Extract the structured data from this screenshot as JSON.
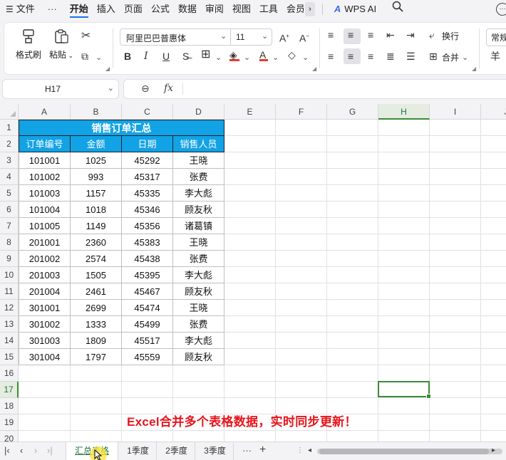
{
  "menubar": {
    "file_icon": "hamburger-menu-icon",
    "file_label": "文件",
    "more_label": "···",
    "items": [
      "开始",
      "插入",
      "页面",
      "公式",
      "数据",
      "审阅",
      "视图",
      "工具",
      "会员"
    ],
    "active": "开始",
    "wps_ai_label": "WPS AI",
    "accent_color": "#1a73e8"
  },
  "ribbon": {
    "format_painter_label": "格式刷",
    "paste_label": "粘贴",
    "font_name": "阿里巴巴普惠体",
    "font_size": "11",
    "bold": "B",
    "italic": "I",
    "underline": "U",
    "wrap_label": "换行",
    "merge_label": "合并",
    "number_format_label": "常规",
    "currency_symbol": "羊"
  },
  "formula_bar": {
    "name_box": "H17",
    "fx_label": "fx",
    "formula": ""
  },
  "grid": {
    "columns": [
      "A",
      "B",
      "C",
      "D",
      "E",
      "F",
      "G",
      "H",
      "I",
      "J"
    ],
    "selected_column": "H",
    "rows": [
      "1",
      "2",
      "3",
      "4",
      "5",
      "6",
      "7",
      "8",
      "9",
      "10",
      "11",
      "12",
      "13",
      "14",
      "15",
      "16",
      "17",
      "18",
      "19",
      "20"
    ],
    "selected_row": "17",
    "table_title": "销售订单汇总",
    "headers": [
      "订单编号",
      "金额",
      "日期",
      "销售人员"
    ],
    "header_fill": "#12a2e6",
    "records": [
      [
        "101001",
        "1025",
        "45292",
        "王晓"
      ],
      [
        "101002",
        "993",
        "45317",
        "张费"
      ],
      [
        "101003",
        "1157",
        "45335",
        "李大彪"
      ],
      [
        "101004",
        "1018",
        "45346",
        "顾友秋"
      ],
      [
        "101005",
        "1149",
        "45356",
        "诸葛镇"
      ],
      [
        "201001",
        "2360",
        "45383",
        "王晓"
      ],
      [
        "201002",
        "2574",
        "45438",
        "张费"
      ],
      [
        "201003",
        "1505",
        "45395",
        "李大彪"
      ],
      [
        "201004",
        "2461",
        "45467",
        "顾友秋"
      ],
      [
        "301001",
        "2699",
        "45474",
        "王晓"
      ],
      [
        "301002",
        "1333",
        "45499",
        "张费"
      ],
      [
        "301003",
        "1809",
        "45517",
        "李大彪"
      ],
      [
        "301004",
        "1797",
        "45559",
        "顾友秋"
      ]
    ],
    "caption": "Excel合并多个表格数据，实时同步更新！",
    "caption_color": "#e8141b"
  },
  "sheet_tabs": {
    "tabs": [
      "汇总表格",
      "1季度",
      "2季度",
      "3季度"
    ],
    "active": "汇总表格",
    "more_label": "···",
    "add_label": "+"
  }
}
